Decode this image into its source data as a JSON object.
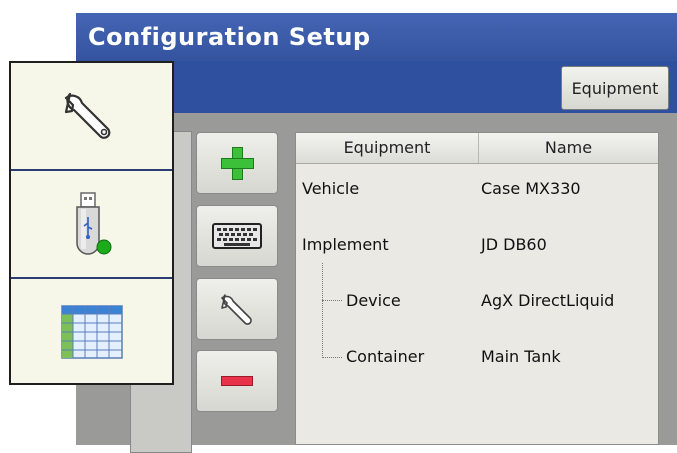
{
  "window": {
    "title": "Configuration Setup"
  },
  "tabs": {
    "equipment_label": "Equipment"
  },
  "toolbar": {
    "add_icon": "plus-icon",
    "keyboard_icon": "keyboard-icon",
    "configure_icon": "wrench-icon",
    "remove_icon": "minus-icon"
  },
  "table": {
    "columns": [
      "Equipment",
      "Name"
    ],
    "rows": [
      {
        "equipment": "Vehicle",
        "name": "Case MX330"
      },
      {
        "equipment": "Implement",
        "name": "JD DB60"
      },
      {
        "equipment": "Device",
        "name": "AgX DirectLiquid"
      },
      {
        "equipment": "Container",
        "name": "Main Tank"
      }
    ]
  },
  "popup_menu": {
    "items": [
      {
        "icon": "wrench-icon"
      },
      {
        "icon": "usb-drive-icon"
      },
      {
        "icon": "table-grid-icon"
      }
    ]
  },
  "colors": {
    "title_bar": "#34539f",
    "add": "#3cc03a",
    "remove": "#e8334a",
    "popup_bg": "#f7f7e9"
  }
}
